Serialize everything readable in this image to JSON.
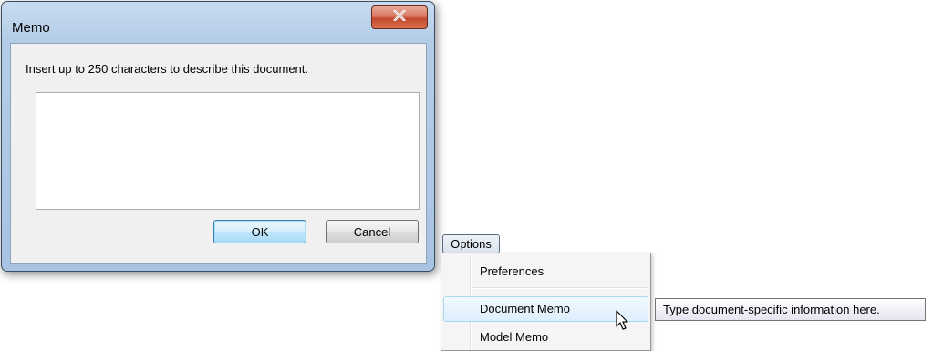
{
  "dialog": {
    "title": "Memo",
    "instruction": "Insert up to 250 characters to describe this document.",
    "memo_value": "",
    "ok_label": "OK",
    "cancel_label": "Cancel",
    "close_icon": "close-icon"
  },
  "options": {
    "button_label": "Options",
    "menu_items": [
      {
        "label": "Preferences",
        "highlighted": false
      },
      {
        "label": "Document Memo",
        "highlighted": true
      },
      {
        "label": "Model Memo",
        "highlighted": false
      }
    ]
  },
  "tooltip": {
    "text": "Type document-specific information here."
  },
  "colors": {
    "frame": "#b4cde7",
    "close_button": "#c34a2f",
    "highlight": "#dcefff"
  }
}
